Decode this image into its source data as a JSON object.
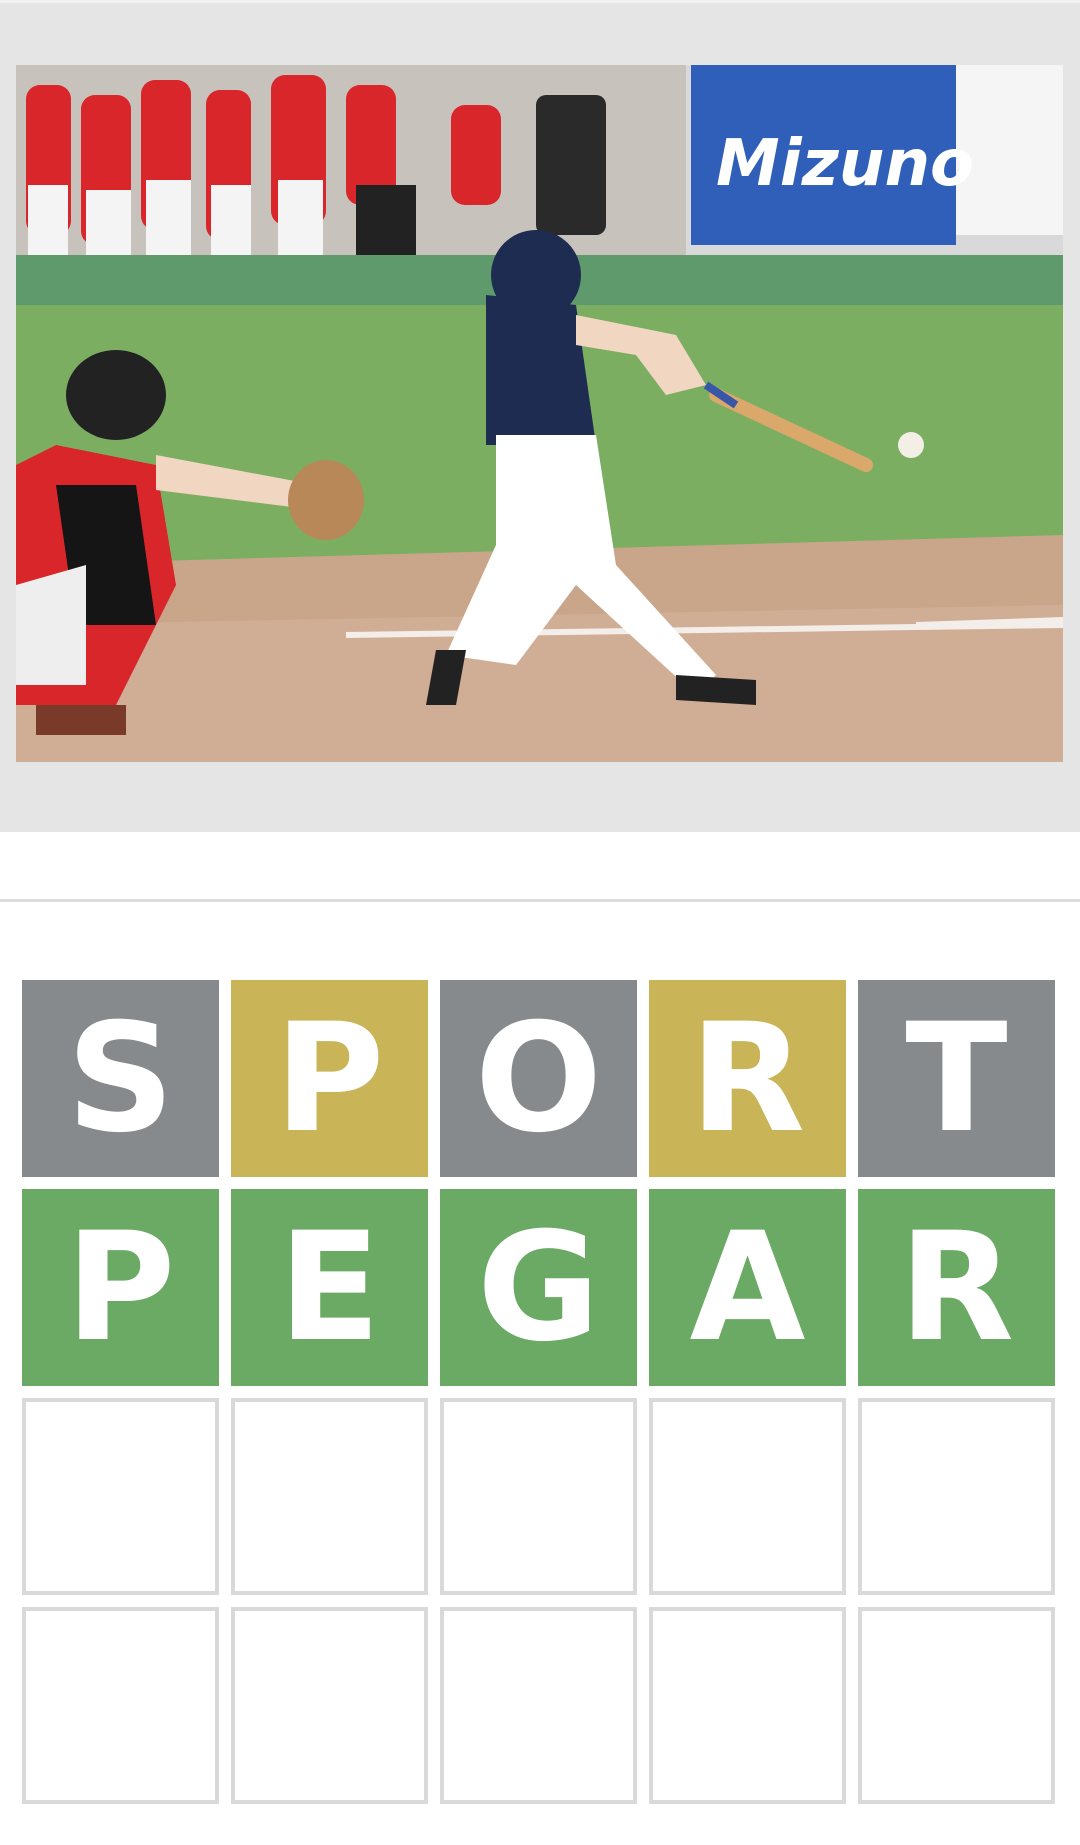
{
  "photo": {
    "subject": "baseball batter swinging at pitch with catcher crouched behind plate",
    "banner_text": "Mizuno"
  },
  "board": {
    "rows": [
      {
        "tiles": [
          {
            "letter": "S",
            "state": "absent"
          },
          {
            "letter": "P",
            "state": "present"
          },
          {
            "letter": "O",
            "state": "absent"
          },
          {
            "letter": "R",
            "state": "present"
          },
          {
            "letter": "T",
            "state": "absent"
          }
        ]
      },
      {
        "tiles": [
          {
            "letter": "P",
            "state": "correct"
          },
          {
            "letter": "E",
            "state": "correct"
          },
          {
            "letter": "G",
            "state": "correct"
          },
          {
            "letter": "A",
            "state": "correct"
          },
          {
            "letter": "R",
            "state": "correct"
          }
        ]
      },
      {
        "tiles": [
          {
            "letter": "",
            "state": "empty"
          },
          {
            "letter": "",
            "state": "empty"
          },
          {
            "letter": "",
            "state": "empty"
          },
          {
            "letter": "",
            "state": "empty"
          },
          {
            "letter": "",
            "state": "empty"
          }
        ]
      },
      {
        "tiles": [
          {
            "letter": "",
            "state": "empty"
          },
          {
            "letter": "",
            "state": "empty"
          },
          {
            "letter": "",
            "state": "empty"
          },
          {
            "letter": "",
            "state": "empty"
          },
          {
            "letter": "",
            "state": "empty"
          }
        ]
      }
    ]
  },
  "colors": {
    "absent": "#878a8c",
    "present": "#c9b458",
    "correct": "#6aaa64",
    "empty_border": "#d9d9d9",
    "panel_bg": "#e5e5e5"
  }
}
